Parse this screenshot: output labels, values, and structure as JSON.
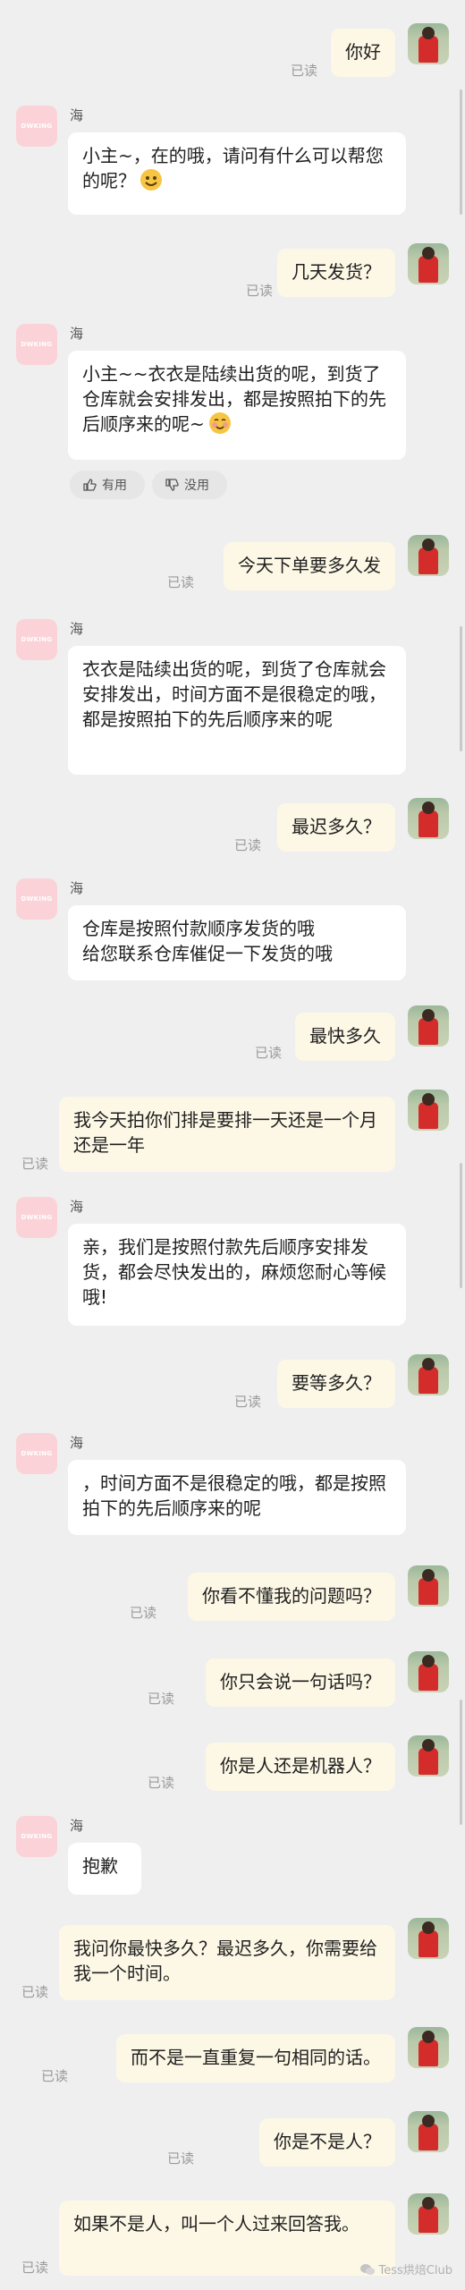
{
  "bot_name": "海",
  "bot_avatar_text": "DWKING",
  "read_label": "已读",
  "feedback": {
    "useful": "有用",
    "useless": "没用"
  },
  "watermark": "Tess烘焙Club",
  "messages": [
    {
      "side": "out",
      "text": "你好"
    },
    {
      "side": "in",
      "text": "小主~，在的哦，请问有什么可以帮您的呢？"
    },
    {
      "side": "out",
      "text": "几天发货？"
    },
    {
      "side": "in",
      "text": "小主~~衣衣是陆续出货的呢，到货了仓库就会安排发出，都是按照拍下的先后顺序来的呢~"
    },
    {
      "side": "out",
      "text": "今天下单要多久发"
    },
    {
      "side": "in",
      "text": "衣衣是陆续出货的呢，到货了仓库就会安排发出，时间方面不是很稳定的哦，都是按照拍下的先后顺序来的呢"
    },
    {
      "side": "out",
      "text": "最迟多久？"
    },
    {
      "side": "in",
      "text": "仓库是按照付款顺序发货的哦\n给您联系仓库催促一下发货的哦"
    },
    {
      "side": "out",
      "text": "最快多久"
    },
    {
      "side": "out",
      "text": "我今天拍你们排是要排一天还是一个月还是一年"
    },
    {
      "side": "in",
      "text": "亲，我们是按照付款先后顺序安排发货，都会尽快发出的，麻烦您耐心等候哦!"
    },
    {
      "side": "out",
      "text": "要等多久？"
    },
    {
      "side": "in",
      "text": "，时间方面不是很稳定的哦，都是按照拍下的先后顺序来的呢"
    },
    {
      "side": "out",
      "text": "你看不懂我的问题吗？"
    },
    {
      "side": "out",
      "text": "你只会说一句话吗？"
    },
    {
      "side": "out",
      "text": "你是人还是机器人？"
    },
    {
      "side": "in",
      "text": "抱歉"
    },
    {
      "side": "out",
      "text": "我问你最快多久？最迟多久，你需要给我一个时间。"
    },
    {
      "side": "out",
      "text": "而不是一直重复一句相同的话。"
    },
    {
      "side": "out",
      "text": "你是不是人？"
    },
    {
      "side": "out",
      "text": "如果不是人，叫一个人过来回答我。"
    }
  ]
}
